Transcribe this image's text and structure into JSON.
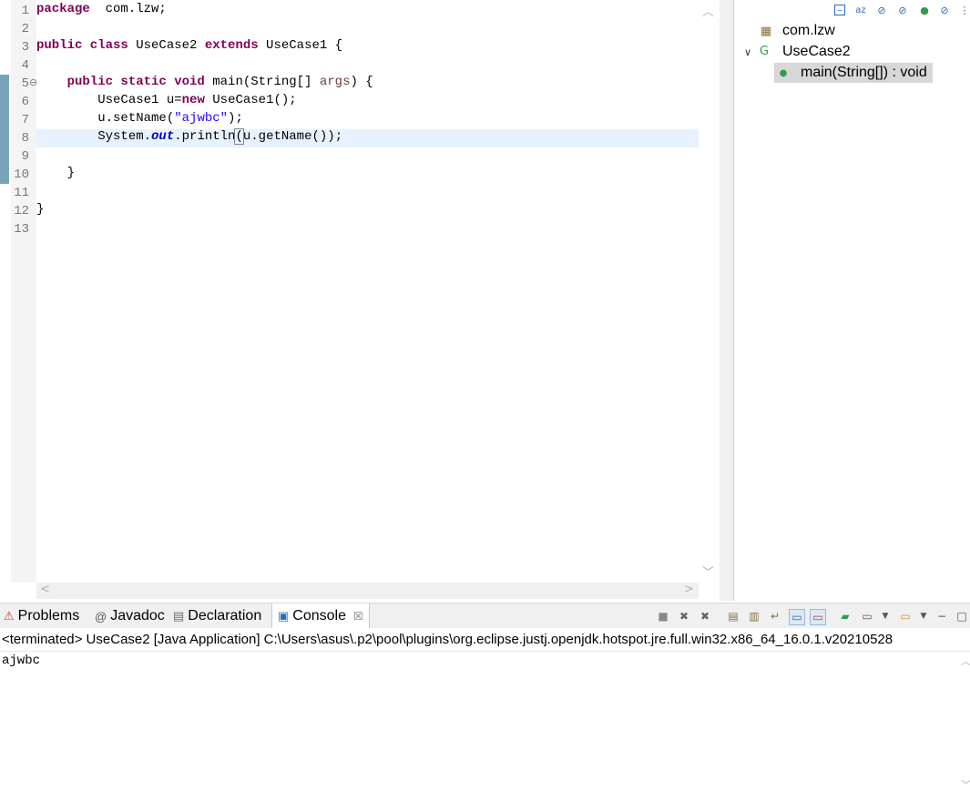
{
  "editor": {
    "line_numbers": [
      "1",
      "2",
      "3",
      "4",
      "5",
      "6",
      "7",
      "8",
      "9",
      "10",
      "11",
      "12",
      "13"
    ],
    "fold_marker": "⊖",
    "current_line": 8
  },
  "outline": {
    "package": "com.lzw",
    "class": "UseCase2",
    "method": "main(String[]) : void",
    "expand_glyph": "∨"
  },
  "console": {
    "tabs": [
      {
        "label": "Problems",
        "icon": "problems-icon"
      },
      {
        "label": "Javadoc",
        "icon": "javadoc-icon"
      },
      {
        "label": "Declaration",
        "icon": "declaration-icon"
      },
      {
        "label": "Console",
        "icon": "console-icon",
        "active": true
      }
    ],
    "close_glyph": "☒",
    "status_line": "<terminated> UseCase2 [Java Application] C:\\Users\\asus\\.p2\\pool\\plugins\\org.eclipse.justj.openjdk.hotspot.jre.full.win32.x86_64_16.0.1.v20210528",
    "output": "ajwbc"
  }
}
